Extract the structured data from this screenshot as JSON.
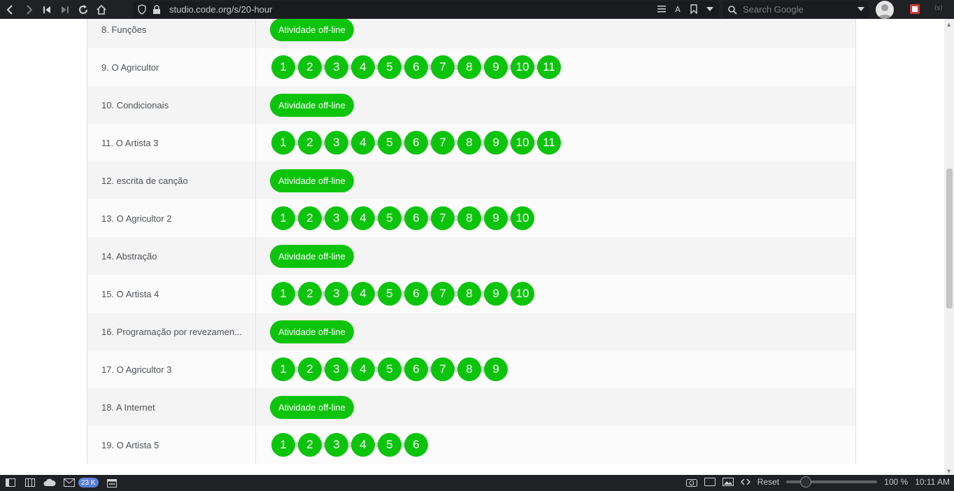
{
  "browser": {
    "url": "studio.code.org/s/20-hour",
    "search_placeholder": "Search Google"
  },
  "lessons": [
    {
      "title": "8. Funções",
      "type": "offline",
      "button": "Atividade off-line"
    },
    {
      "title": "9. O Agricultor",
      "type": "levels",
      "levels": [
        "1",
        "2",
        "3",
        "4",
        "5",
        "6",
        "7",
        "8",
        "9",
        "10",
        "11"
      ]
    },
    {
      "title": "10. Condicionais",
      "type": "offline",
      "button": "Atividade off-line"
    },
    {
      "title": "11. O Artista 3",
      "type": "levels",
      "levels": [
        "1",
        "2",
        "3",
        "4",
        "5",
        "6",
        "7",
        "8",
        "9",
        "10",
        "11"
      ]
    },
    {
      "title": "12. escrita de canção",
      "type": "offline",
      "button": "Atividade off-line"
    },
    {
      "title": "13. O Agricultor 2",
      "type": "levels",
      "levels": [
        "1",
        "2",
        "3",
        "4",
        "5",
        "6",
        "7",
        "8",
        "9",
        "10"
      ]
    },
    {
      "title": "14. Abstração",
      "type": "offline",
      "button": "Atividade off-line"
    },
    {
      "title": "15. O Artista 4",
      "type": "levels",
      "levels": [
        "1",
        "2",
        "3",
        "4",
        "5",
        "6",
        "7",
        "8",
        "9",
        "10"
      ]
    },
    {
      "title": "16. Programação por revezamen...",
      "type": "offline",
      "button": "Atividade off-line"
    },
    {
      "title": "17. O Agricultor 3",
      "type": "levels",
      "levels": [
        "1",
        "2",
        "3",
        "4",
        "5",
        "6",
        "7",
        "8",
        "9"
      ]
    },
    {
      "title": "18. A Internet",
      "type": "offline",
      "button": "Atividade off-line"
    },
    {
      "title": "19. O Artista 5",
      "type": "levels",
      "levels": [
        "1",
        "2",
        "3",
        "4",
        "5",
        "6"
      ]
    }
  ],
  "statusbar": {
    "mail_badge": "23 K",
    "reset_label": "Reset",
    "zoom": "100 %",
    "clock": "10:11 AM"
  }
}
